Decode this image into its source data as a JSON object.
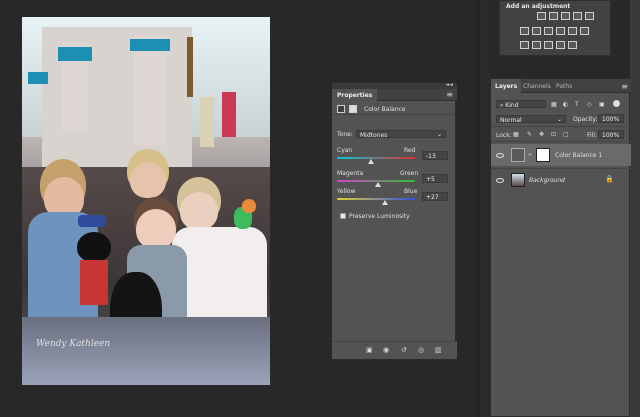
{
  "adjustments": {
    "title": "Add an adjustment",
    "row1": [
      "brightness-icon",
      "levels-icon",
      "curves-icon",
      "exposure-icon",
      "gradient-icon"
    ],
    "row2": [
      "vibrance-icon",
      "color-balance-icon",
      "bw-icon",
      "photo-filter-icon",
      "channel-mixer-icon",
      "lookup-icon"
    ],
    "row3": [
      "invert-icon",
      "posterize-icon",
      "threshold-icon",
      "selective-color-icon",
      "gradient-map-icon"
    ]
  },
  "properties": {
    "tab": "Properties",
    "title": "Color Balance",
    "tone_label": "Tone:",
    "tone_value": "Midtones",
    "sliders": [
      {
        "left": "Cyan",
        "right": "Red",
        "value": "-13",
        "pos": 0.44,
        "color_left": "#00c8d8",
        "color_right": "#e03030"
      },
      {
        "left": "Magenta",
        "right": "Green",
        "value": "+5",
        "pos": 0.52,
        "color_left": "#d040d0",
        "color_right": "#30c030"
      },
      {
        "left": "Yellow",
        "right": "Blue",
        "value": "+27",
        "pos": 0.62,
        "color_left": "#e0d030",
        "color_right": "#3050e0"
      }
    ],
    "preserve": "Preserve Luminosity",
    "collapse_glyph": "◄◄",
    "menu_glyph": "≡"
  },
  "layers": {
    "tabs": [
      "Layers",
      "Channels",
      "Paths"
    ],
    "kind_label": "Kind",
    "blend_mode": "Normal",
    "opacity_label": "Opacity:",
    "opacity_value": "100%",
    "lock_label": "Lock:",
    "fill_label": "Fill:",
    "fill_value": "100%",
    "items": [
      {
        "name": "Color Balance 1",
        "selected": true
      },
      {
        "name": "Background",
        "selected": false
      }
    ],
    "lock_glyph": "🔒"
  },
  "photo": {
    "signature": "Wendy Kathleen"
  }
}
